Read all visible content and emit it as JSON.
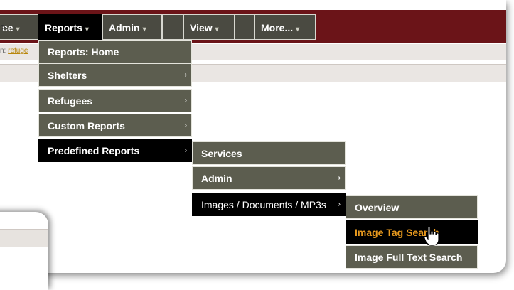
{
  "nav": {
    "items": [
      {
        "label": "ce",
        "chevron": "▾"
      },
      {
        "label": "Reports",
        "chevron": "▾"
      },
      {
        "label": "Admin",
        "chevron": "▾"
      },
      {
        "label": "View",
        "chevron": "▾"
      },
      {
        "label": "More...",
        "chevron": "▾"
      }
    ]
  },
  "left_fragment": "?",
  "breadcrumb": {
    "prefix": "n:",
    "link": "refuge"
  },
  "reports_menu": [
    {
      "label": "Reports: Home",
      "submenu": false
    },
    {
      "label": "Shelters",
      "submenu": true
    },
    {
      "label": "Refugees",
      "submenu": true
    },
    {
      "label": "Custom Reports",
      "submenu": true
    },
    {
      "label": "Predefined Reports",
      "submenu": true,
      "active": true
    }
  ],
  "predefined_menu": [
    {
      "label": "Services",
      "submenu": false
    },
    {
      "label": "Admin",
      "submenu": true
    },
    {
      "label": "Images / Documents / MP3s",
      "submenu": true,
      "active": true
    }
  ],
  "images_menu": [
    {
      "label": "Overview"
    },
    {
      "label": "Image Tag Search",
      "hovered": true
    },
    {
      "label": "Image Full Text Search"
    }
  ],
  "arrow_glyph": "›",
  "colors": {
    "topbar": "#6b1418",
    "menu_bg": "#5c5d4f",
    "active_bg": "#000000",
    "hover_text": "#e89a1e"
  }
}
